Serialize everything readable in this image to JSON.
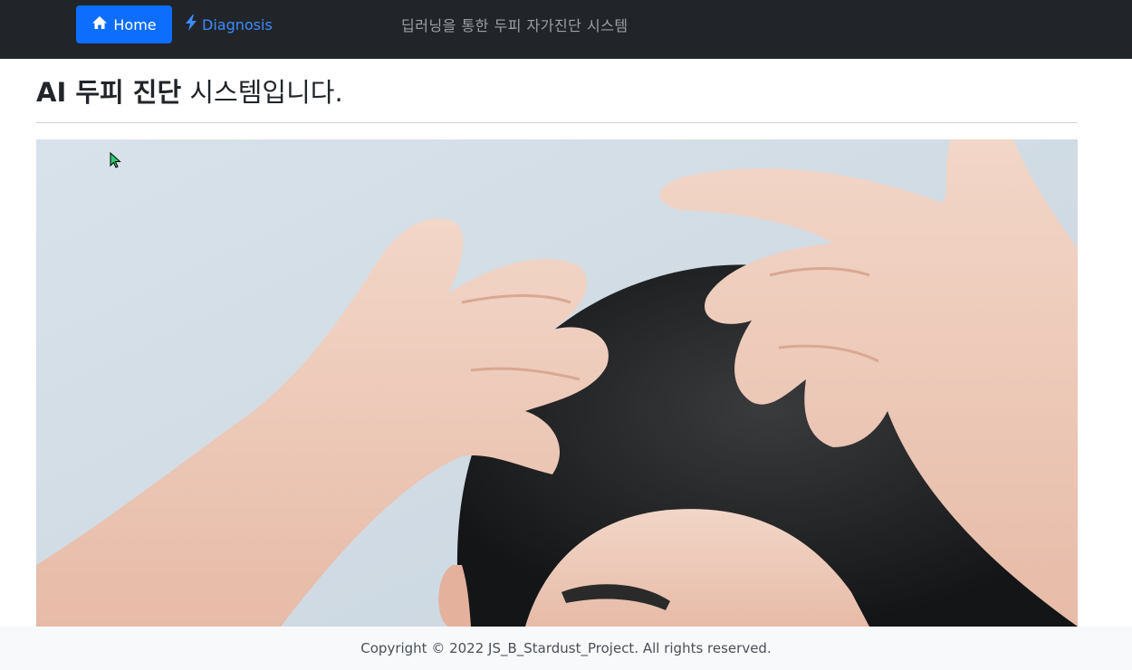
{
  "navbar": {
    "home_label": "Home",
    "home_icon": "house-icon",
    "diagnosis_label": "Diagnosis",
    "diagnosis_icon": "lightning-icon",
    "brand_text": "딥러닝을 통한 두피 자가진단 시스템",
    "colors": {
      "background": "#212529",
      "active": "#0d6efd",
      "link": "#3d8bfd"
    }
  },
  "main": {
    "title_bold": "AI 두피 진단",
    "title_rest": " 시스템입니다.",
    "hero_image": "person-scratching-scalp-photo"
  },
  "footer": {
    "copyright": "Copyright © 2022 JS_B_Stardust_Project. All rights reserved."
  }
}
